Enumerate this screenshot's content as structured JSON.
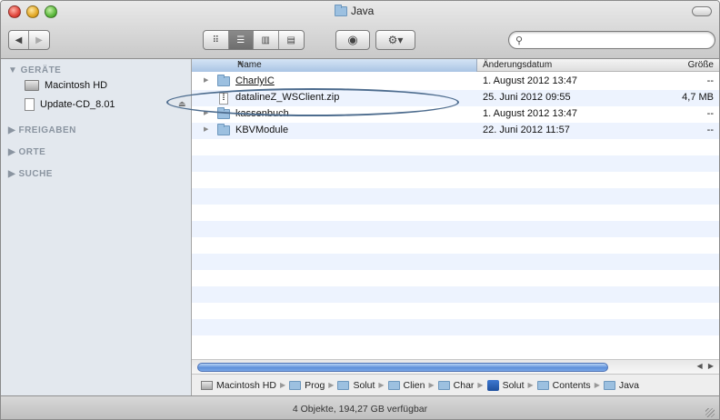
{
  "window": {
    "title": "Java",
    "status": "4 Objekte, 194,27 GB verfügbar"
  },
  "toolbar": {
    "back_label": "◀",
    "forward_label": "▶",
    "view_icons_label": "⠿",
    "view_list_label": "☰",
    "view_columns_label": "▥",
    "view_coverflow_label": "▤",
    "quicklook_label": "◉",
    "action_label": "⚙▾",
    "search_placeholder": "",
    "search_icon": "🔍"
  },
  "sidebar": {
    "sections": [
      {
        "label": "▼ GERÄTE"
      },
      {
        "label": "▶ FREIGABEN"
      },
      {
        "label": "▶ ORTE"
      },
      {
        "label": "▶ SUCHE"
      }
    ],
    "devices": [
      {
        "label": "Macintosh HD",
        "icon": "hard-drive-icon"
      },
      {
        "label": "Update-CD_8.01",
        "icon": "disk-image-icon"
      }
    ],
    "eject": "⏏"
  },
  "list": {
    "headers": {
      "name": "Name",
      "date": "Änderungsdatum",
      "size": "Größe",
      "sort_indicator": "▲"
    },
    "rows": [
      {
        "name": "CharlyIC",
        "date": "1. August 2012 13:47",
        "size": "--",
        "kind": "folder"
      },
      {
        "name": "datalineZ_WSClient.zip",
        "date": "25. Juni 2012 09:55",
        "size": "4,7 MB",
        "kind": "zip"
      },
      {
        "name": "kassenbuch",
        "date": "1. August 2012 13:47",
        "size": "--",
        "kind": "folder"
      },
      {
        "name": "KBVModule",
        "date": "22. Juni 2012 11:57",
        "size": "--",
        "kind": "folder"
      }
    ]
  },
  "pathbar": {
    "items": [
      {
        "label": "Macintosh HD",
        "icon": "hard-drive-icon"
      },
      {
        "label": "Prog",
        "icon": "folder-icon"
      },
      {
        "label": "Solut",
        "icon": "folder-icon"
      },
      {
        "label": "Clien",
        "icon": "folder-icon"
      },
      {
        "label": "Char",
        "icon": "folder-icon"
      },
      {
        "label": "Solut",
        "icon": "app-icon"
      },
      {
        "label": "Contents",
        "icon": "folder-icon"
      },
      {
        "label": "Java",
        "icon": "folder-icon"
      }
    ],
    "separator": "▶"
  },
  "scrollbar": {
    "arrows": "◀ ▶"
  },
  "colors": {
    "accent": "#5e90da",
    "selection": "#edf3fe",
    "sidebar": "#e3e8ee",
    "annotation": "#4d6c8e"
  }
}
